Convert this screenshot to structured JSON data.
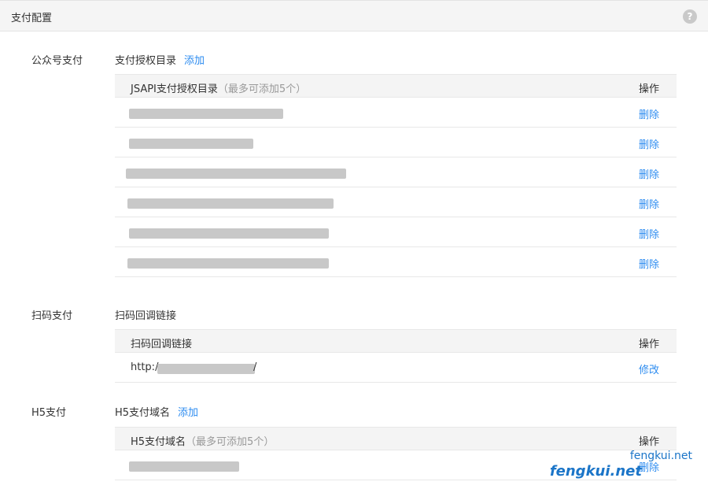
{
  "header": {
    "title": "支付配置"
  },
  "icons": {
    "help": "help-icon"
  },
  "mp_pay": {
    "label": "公众号支付",
    "subtitle": "支付授权目录",
    "add_label": "添加",
    "table": {
      "col_main": "JSAPI支付授权目录",
      "col_hint": "（最多可添加5个）",
      "col_op": "操作",
      "rows": [
        {
          "op": "删除"
        },
        {
          "op": "删除"
        },
        {
          "op": "删除"
        },
        {
          "op": "删除"
        },
        {
          "op": "删除"
        },
        {
          "op": "删除"
        }
      ]
    }
  },
  "scan_pay": {
    "label": "扫码支付",
    "subtitle": "扫码回调链接",
    "table": {
      "col_main": "扫码回调链接",
      "col_op": "操作",
      "rows": [
        {
          "prefix": "http:/",
          "suffix": "/",
          "op": "修改"
        }
      ]
    }
  },
  "h5_pay": {
    "label": "H5支付",
    "subtitle": "H5支付域名",
    "add_label": "添加",
    "table": {
      "col_main": "H5支付域名",
      "col_hint": "（最多可添加5个）",
      "col_op": "操作",
      "rows": [
        {
          "op": "删除"
        }
      ]
    }
  },
  "watermark": {
    "line1": "fengkui.net",
    "line2": "fengkui.net"
  }
}
